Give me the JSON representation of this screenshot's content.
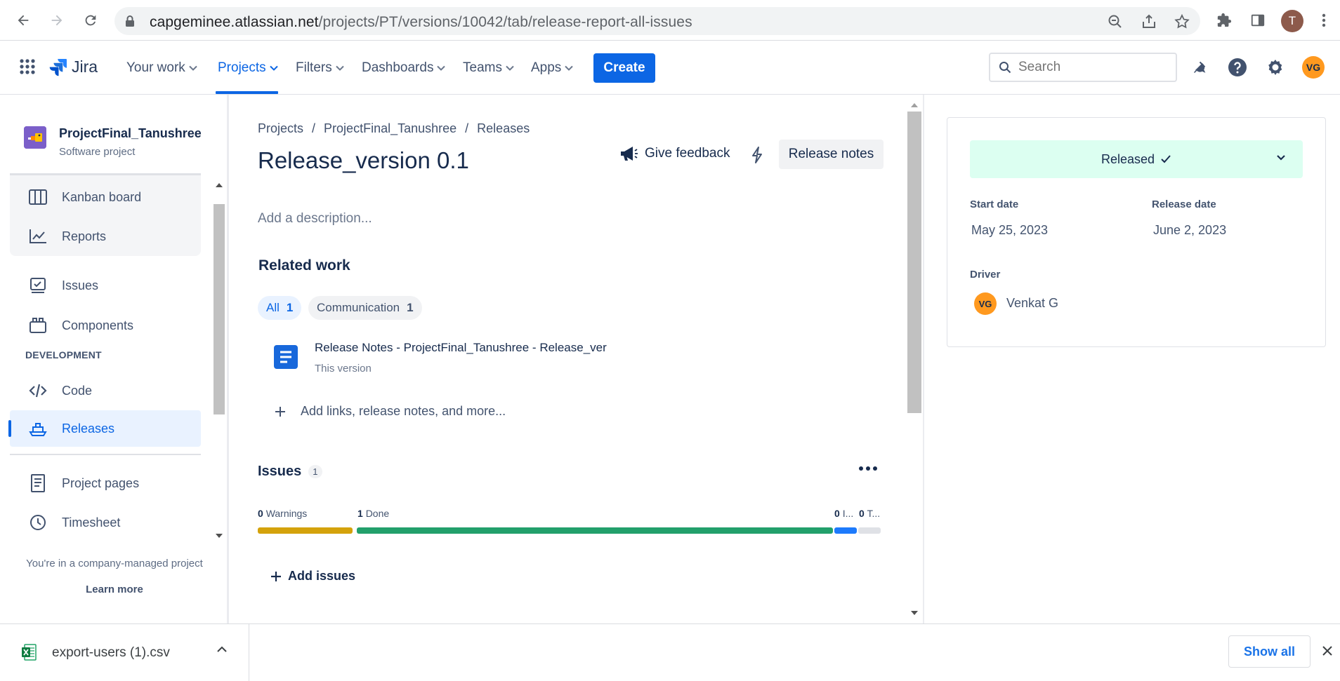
{
  "browser": {
    "url_host": "capgeminee.atlassian.net",
    "url_path": "/projects/PT/versions/10042/tab/release-report-all-issues",
    "profile_initial": "T"
  },
  "topnav": {
    "product": "Jira",
    "items": [
      {
        "label": "Your work"
      },
      {
        "label": "Projects"
      },
      {
        "label": "Filters"
      },
      {
        "label": "Dashboards"
      },
      {
        "label": "Teams"
      },
      {
        "label": "Apps"
      }
    ],
    "active_item": "Projects",
    "create_label": "Create",
    "search_placeholder": "Search",
    "user_initials": "VG",
    "brand_color": "#0c66e4"
  },
  "sidebar": {
    "project_name": "ProjectFinal_Tanushree",
    "project_type": "Software project",
    "group_items": [
      {
        "label": "Kanban board",
        "icon": "board-icon"
      },
      {
        "label": "Reports",
        "icon": "reports-icon"
      }
    ],
    "items": [
      {
        "label": "Issues",
        "icon": "issues-icon"
      },
      {
        "label": "Components",
        "icon": "components-icon"
      }
    ],
    "section_title": "DEVELOPMENT",
    "dev_items": [
      {
        "label": "Code",
        "icon": "code-icon"
      },
      {
        "label": "Releases",
        "icon": "releases-icon",
        "active": true
      }
    ],
    "bottom_items": [
      {
        "label": "Project pages",
        "icon": "pages-icon"
      },
      {
        "label": "Timesheet",
        "icon": "clock-icon"
      }
    ],
    "footer_text": "You're in a company-managed project",
    "footer_link": "Learn more"
  },
  "main": {
    "breadcrumb": [
      "Projects",
      "/",
      "ProjectFinal_Tanushree",
      "/",
      "Releases"
    ],
    "title": "Release_version 0.1",
    "feedback_label": "Give feedback",
    "release_notes_label": "Release notes",
    "description_placeholder": "Add a description...",
    "related_work_title": "Related work",
    "chips": [
      {
        "label": "All",
        "count": "1",
        "selected": true
      },
      {
        "label": "Communication",
        "count": "1",
        "selected": false
      }
    ],
    "related_item": {
      "title": "Release Notes - ProjectFinal_Tanushree - Release_ver",
      "subtitle": "This version"
    },
    "add_links_label": "Add links, release notes, and more...",
    "issues_title": "Issues",
    "issues_count": "1",
    "status": {
      "warnings_count": "0",
      "warnings_label": "Warnings",
      "done_count": "1",
      "done_label": "Done",
      "in_progress_count": "0",
      "in_progress_label": "I...",
      "todo_count": "0",
      "todo_label": "T...",
      "colors": {
        "warnings": "#d4a20b",
        "done": "#22a06b",
        "in_progress": "#1d7afc",
        "todo": "#dfe1e6"
      }
    },
    "add_issues_label": "Add issues"
  },
  "details": {
    "status_label": "Released",
    "status_color": "#dcfff1",
    "start_date_label": "Start date",
    "start_date": "May 25, 2023",
    "release_date_label": "Release date",
    "release_date": "June 2, 2023",
    "driver_label": "Driver",
    "driver_initials": "VG",
    "driver_name": "Venkat G"
  },
  "downloads": {
    "file_name": "export-users (1).csv",
    "show_all_label": "Show all"
  }
}
